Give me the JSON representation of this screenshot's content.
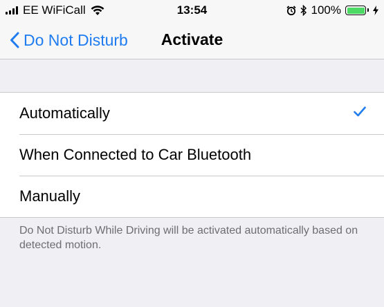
{
  "status_bar": {
    "carrier": "EE WiFiCall",
    "time": "13:54",
    "battery_percent": "100%",
    "battery_level": 1.0,
    "battery_color": "#4cd964",
    "icons": [
      "signal-bars-icon",
      "wifi-icon",
      "alarm-clock-icon",
      "bluetooth-icon",
      "battery-icon",
      "charging-bolt-icon"
    ]
  },
  "nav": {
    "back_label": "Do Not Disturb",
    "title": "Activate",
    "accent_color": "#1e7cf0"
  },
  "options": [
    {
      "label": "Automatically",
      "selected": true
    },
    {
      "label": "When Connected to Car Bluetooth",
      "selected": false
    },
    {
      "label": "Manually",
      "selected": false
    }
  ],
  "footer_note": "Do Not Disturb While Driving will be activated automatically based on detected motion."
}
